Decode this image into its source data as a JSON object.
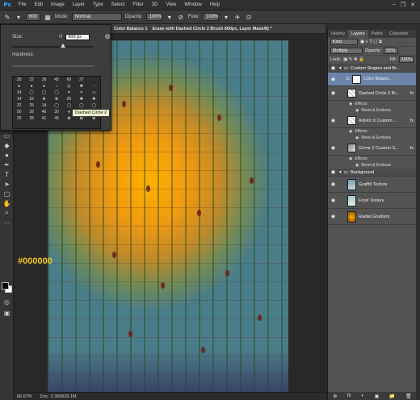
{
  "menubar": {
    "logo": "Ps",
    "items": [
      "File",
      "Edit",
      "Image",
      "Layer",
      "Type",
      "Select",
      "Filter",
      "3D",
      "View",
      "Window",
      "Help"
    ],
    "win_min": "–",
    "win_max": "❐",
    "win_close": "✕"
  },
  "options": {
    "brush_size": "600",
    "mode_label": "Mode:",
    "mode_value": "Normal",
    "opacity_label": "Opacity:",
    "opacity_value": "100%",
    "flow_label": "Flow:",
    "flow_value": "100%"
  },
  "document": {
    "tab_title": "Erase with Dashed Circle 2 Brush 600px, Layer Mask/8) *",
    "tab_prefix": "Color Balance 1",
    "zoom": "66.67%",
    "doc_info": "Doc: 3.35M/26.1M",
    "annotation": "#000000"
  },
  "brush_picker": {
    "size_label": "Size:",
    "size_value": "600 px",
    "hardness_label": "Hardness:",
    "tooltip": "Dashed Circle 2",
    "rows": [
      [
        "28",
        "22",
        "36",
        "45",
        "60",
        "27",
        ""
      ],
      [
        "",
        "",
        "",
        "",
        "",
        "",
        ""
      ],
      [
        "14",
        "",
        "",
        "",
        "",
        "",
        ""
      ],
      [
        "14",
        "15",
        "",
        "",
        "26",
        "",
        ""
      ],
      [
        "32",
        "25",
        "14",
        "",
        "",
        "",
        ""
      ],
      [
        "50",
        "28",
        "40",
        "30",
        "",
        "",
        ""
      ],
      [
        "25",
        "28",
        "41",
        "45",
        "",
        "",
        ""
      ],
      [
        "",
        "",
        "",
        "",
        "",
        "",
        ""
      ]
    ]
  },
  "layers_panel": {
    "tabs": [
      "History",
      "Layers",
      "Paths",
      "Channels"
    ],
    "active_tab": "Layers",
    "kind_label": "Kind",
    "blend_mode": "Multiply",
    "opacity_label": "Opacity:",
    "opacity_value": "55%",
    "lock_label": "Lock:",
    "fill_label": "Fill:",
    "fill_value": "100%",
    "group1": "Custom Shapes and Br...",
    "layers": [
      {
        "name": "Color Balanc...",
        "selected": true
      },
      {
        "name": "Dashed Circle 2 Br...",
        "selected": false
      },
      {
        "name": "Artistic 6 Custom ...",
        "selected": false
      },
      {
        "name": "Grime 2 Custom S...",
        "selected": false
      }
    ],
    "effects_label": "Effects",
    "bevel_label": "Bevel & Emboss",
    "group2": "Background",
    "bg_layers": [
      "Graffiti Texture",
      "Frost Texture",
      "Radial Gradient"
    ],
    "footer": [
      "⊕",
      "fx",
      "◐",
      "▣",
      "📁",
      "🗑"
    ]
  },
  "colors": {
    "accent": "#6b84a8",
    "annotation": "#f5c518",
    "foreground": "#000000",
    "background": "#ffffff"
  }
}
